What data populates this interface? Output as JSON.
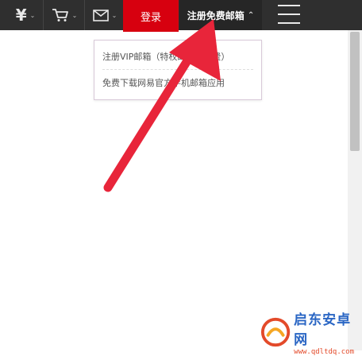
{
  "topbar": {
    "money_icon_glyph": "¥",
    "login_label": "登录",
    "register_label": "注册免费邮箱",
    "chevron_glyph": "⌃",
    "dropdown_chevron_glyph": "⌄"
  },
  "dropdown": {
    "items": [
      {
        "label": "注册VIP邮箱（特权邮箱，付费）"
      },
      {
        "label": "免费下载网易官方手机邮箱应用"
      }
    ]
  },
  "watermark": {
    "name": "启东安卓网",
    "url": "www.qdltdq.com"
  },
  "colors": {
    "topbar_bg": "#2f2f2f",
    "login_bg": "#d7000f",
    "register_bg": "#262626",
    "arrow": "#e8253a",
    "watermark_blue": "#2a66c4",
    "watermark_red": "#e34a2a"
  },
  "icons": [
    "money-icon",
    "cart-icon",
    "mail-icon",
    "chevron-down-icon",
    "chevron-up-icon",
    "menu-icon",
    "arrow-annotation",
    "watermark-logo-icon"
  ]
}
